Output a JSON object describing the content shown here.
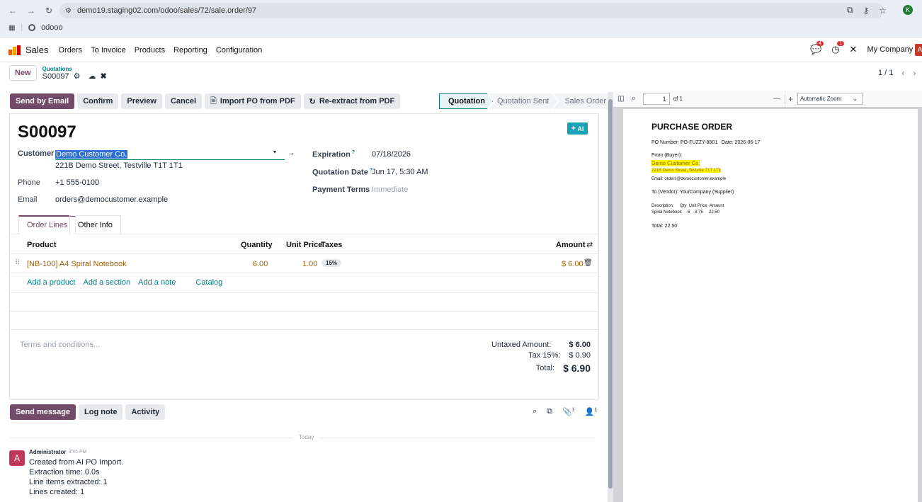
{
  "browser": {
    "url": "demo19.staging02.com/odoo/sales/72/sale.order/97",
    "bookmark": "odooo",
    "profile_initial": "K"
  },
  "nav": {
    "app": "Sales",
    "items": [
      "Orders",
      "To Invoice",
      "Products",
      "Reporting",
      "Configuration"
    ],
    "chat_badge": "4",
    "activity_badge": "1",
    "company": "My Company",
    "user_initial": "A"
  },
  "control": {
    "new_label": "New",
    "breadcrumb_parent": "Quotations",
    "record_name": "S00097",
    "pager": "1 / 1"
  },
  "actions": {
    "send_email": "Send by Email",
    "confirm": "Confirm",
    "preview": "Preview",
    "cancel": "Cancel",
    "import_pdf": "Import PO from PDF",
    "reextract": "Re-extract from PDF"
  },
  "status": {
    "steps": [
      "Quotation",
      "Quotation Sent",
      "Sales Order"
    ],
    "active": "Quotation"
  },
  "form": {
    "ai_badge": "AI",
    "title": "S00097",
    "customer_label": "Customer",
    "customer": "Demo Customer Co.",
    "address": "221B Demo Street, Testville T1T 1T1",
    "phone_label": "Phone",
    "phone": "+1 555-0100",
    "email_label": "Email",
    "email": "orders@democustomer.example",
    "expiration_label": "Expiration",
    "expiration": "07/18/2026",
    "qdate_label": "Quotation Date",
    "qdate": "Jun 17, 5:30 AM",
    "terms_label": "Payment Terms",
    "terms_placeholder": "Immediate",
    "help_mark": "?"
  },
  "tabs": [
    "Order Lines",
    "Other Info"
  ],
  "table": {
    "headers": {
      "product": "Product",
      "quantity": "Quantity",
      "unit_price": "Unit Price",
      "taxes": "Taxes",
      "amount": "Amount"
    },
    "rows": [
      {
        "product": "[NB-100] A4 Spiral Notebook",
        "quantity": "6.00",
        "unit_price": "1.00",
        "tax": "15%",
        "amount": "$ 6.00"
      }
    ],
    "add_product": "Add a product",
    "add_section": "Add a section",
    "add_note": "Add a note",
    "catalog": "Catalog"
  },
  "totals": {
    "terms_placeholder": "Terms and conditions...",
    "untaxed_label": "Untaxed Amount:",
    "untaxed": "$ 6.00",
    "tax_label": "Tax 15%:",
    "tax": "$ 0.90",
    "total_label": "Total:",
    "total": "$ 6.90"
  },
  "chatter": {
    "send_message": "Send message",
    "log_note": "Log note",
    "activity": "Activity",
    "attachments_count": "1",
    "followers_count": "1",
    "divider": "Today",
    "author": "Administrator",
    "time": "3:46 PM",
    "avatar": "A",
    "lines": [
      "Created from AI PO Import.",
      "Extraction time: 0.0s",
      "Line items extracted: 1",
      "Lines created: 1"
    ]
  },
  "pdf": {
    "page_input": "1",
    "page_of": "of 1",
    "zoom_minus": "—",
    "zoom_plus": "+",
    "zoom": "Automatic Zoom",
    "heading": "PURCHASE ORDER",
    "meta": "PO Number: PO-FUZZY-8801   Date: 2026-06-17",
    "from_label": "From (Buyer):",
    "buyer": "Demo Customer Co.",
    "buyer_address": "221B Demo Street, Testville T1T 1T1",
    "buyer_email": "Email: orders@democustomer.example",
    "vendor": "To (Vendor): YourCompany (Supplier)",
    "col_headers": "Description      Qty  Unit Price  Amount",
    "line": "Spiral Notebook     6    3.75     22.50",
    "total": "Total: 22.50"
  },
  "colors": {
    "primary": "#714b67",
    "teal": "#017e84",
    "product": "#a5630a",
    "pdf_bg": "#d4d4d7"
  }
}
